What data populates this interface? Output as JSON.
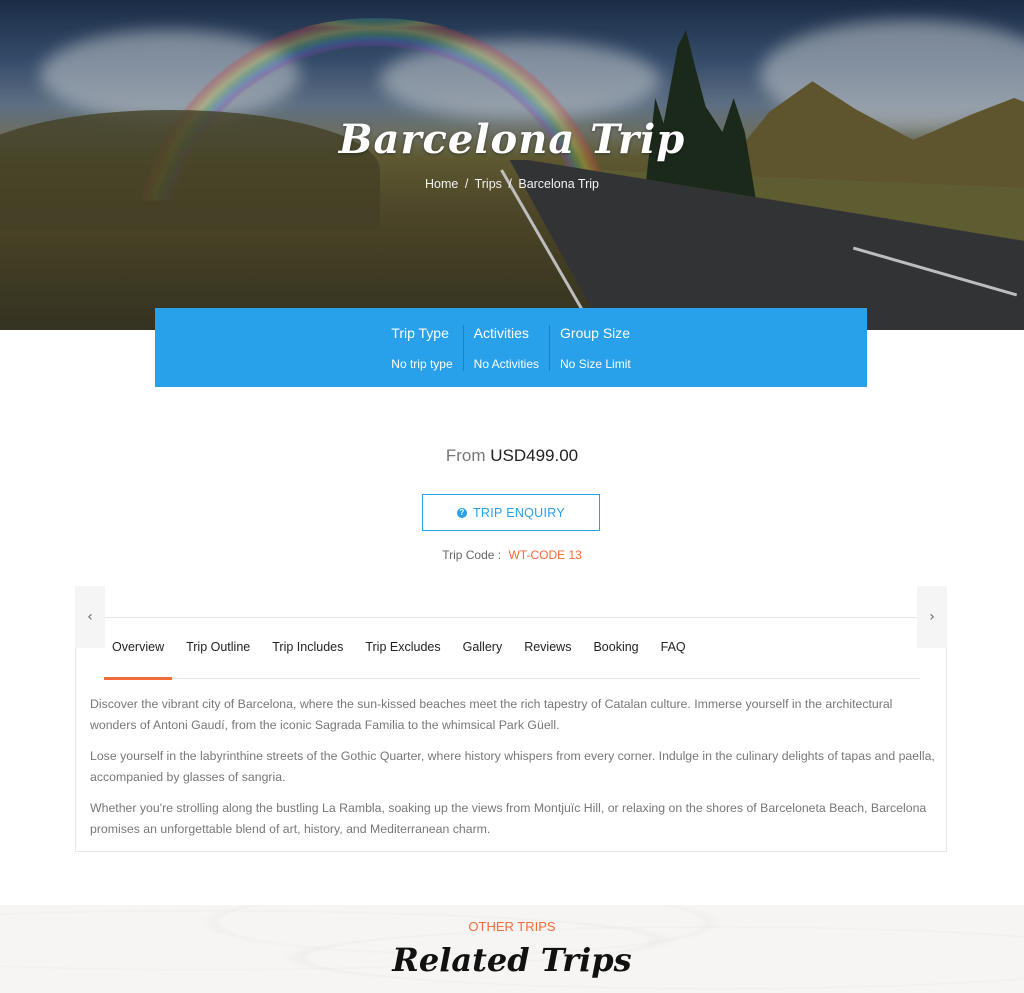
{
  "hero": {
    "title": "Barcelona Trip",
    "breadcrumb": [
      {
        "label": "Home"
      },
      {
        "label": "Trips"
      },
      {
        "label": "Barcelona Trip"
      }
    ],
    "separator": "/"
  },
  "info_bar": {
    "background": "#29a0ea",
    "items": [
      {
        "label": "Trip Type",
        "value": "No trip type"
      },
      {
        "label": "Activities",
        "value": "No Activities"
      },
      {
        "label": "Group Size",
        "value": "No Size Limit"
      }
    ]
  },
  "price": {
    "from_label": "From",
    "amount": "USD499.00"
  },
  "enquiry": {
    "icon": "question-circle-icon",
    "icon_glyph": "?",
    "label": "TRIP ENQUIRY"
  },
  "trip_code": {
    "label": "Trip Code :",
    "value": "WT-CODE 13"
  },
  "tabs": {
    "prev_glyph": "‹",
    "next_glyph": "›",
    "items": [
      {
        "label": "Overview",
        "active": true
      },
      {
        "label": "Trip Outline"
      },
      {
        "label": "Trip Includes"
      },
      {
        "label": "Trip Excludes"
      },
      {
        "label": "Gallery"
      },
      {
        "label": "Reviews"
      },
      {
        "label": "Booking"
      },
      {
        "label": "FAQ"
      }
    ],
    "content": [
      "Discover the vibrant city of Barcelona, where the sun-kissed beaches meet the rich tapestry of Catalan culture. Immerse yourself in the architectural wonders of Antoni Gaudí, from the iconic Sagrada Familia to the whimsical Park Güell.",
      "Lose yourself in the labyrinthine streets of the Gothic Quarter, where history whispers from every corner. Indulge in the culinary delights of tapas and paella, accompanied by glasses of sangria.",
      "Whether you're strolling along the bustling La Rambla, soaking up the views from Montjuïc Hill, or relaxing on the shores of Barceloneta Beach, Barcelona promises an unforgettable blend of art, history, and Mediterranean charm."
    ]
  },
  "related": {
    "eyebrow": "OTHER TRIPS",
    "heading": "Related Trips"
  },
  "colors": {
    "accent_blue": "#29a0ea",
    "accent_orange": "#f26b3a"
  }
}
